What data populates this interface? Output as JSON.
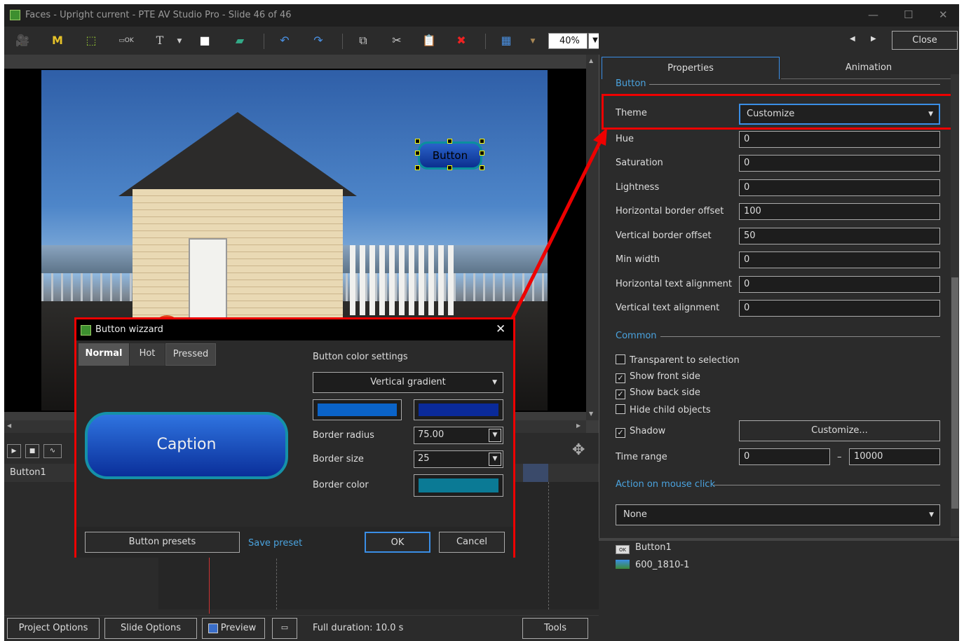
{
  "window": {
    "title": "Faces - Upright current - PTE AV Studio Pro - Slide 46 of 46",
    "close_label": "Close"
  },
  "toolbar": {
    "zoom_value": "40%",
    "icons": [
      "camera-icon",
      "m-icon",
      "frame-icon",
      "ok-button-icon",
      "text-icon",
      "rectangle-icon",
      "image-icon",
      "undo-icon",
      "redo-icon",
      "copy-icon",
      "cut-icon",
      "paste-icon",
      "delete-icon",
      "grid-icon"
    ]
  },
  "stage": {
    "button_object_label": "Button"
  },
  "timeline": {
    "object_label": "Button1"
  },
  "bottom_bar": {
    "project_options": "Project Options",
    "slide_options": "Slide Options",
    "preview": "Preview",
    "full_duration": "Full duration: 10.0 s",
    "tools": "Tools"
  },
  "panel": {
    "tabs": {
      "properties": "Properties",
      "animation": "Animation"
    },
    "button_section": "Button",
    "theme_label": "Theme",
    "theme_value": "Customize",
    "fields": [
      {
        "label": "Hue",
        "value": "0"
      },
      {
        "label": "Saturation",
        "value": "0"
      },
      {
        "label": "Lightness",
        "value": "0"
      },
      {
        "label": "Horizontal border offset",
        "value": "100"
      },
      {
        "label": "Vertical border offset",
        "value": "50"
      },
      {
        "label": "Min width",
        "value": "0"
      },
      {
        "label": "Horizontal text alignment",
        "value": "0"
      },
      {
        "label": "Vertical text alignment",
        "value": "0"
      }
    ],
    "common_section": "Common",
    "checkboxes": [
      {
        "label": "Transparent to selection",
        "checked": false
      },
      {
        "label": "Show front side",
        "checked": true
      },
      {
        "label": "Show back side",
        "checked": true
      },
      {
        "label": "Hide child objects",
        "checked": false
      }
    ],
    "shadow_label": "Shadow",
    "shadow_checked": true,
    "shadow_button": "Customize...",
    "time_range_label": "Time range",
    "time_range_from": "0",
    "time_range_dash": "–",
    "time_range_to": "10000",
    "action_section": "Action on mouse click",
    "action_value": "None"
  },
  "objects": [
    {
      "name": "Button1",
      "icon": "ok-button-icon"
    },
    {
      "name": "600_1810-1",
      "icon": "image-icon"
    }
  ],
  "dialog": {
    "title": "Button wizzard",
    "tabs": {
      "normal": "Normal",
      "hot": "Hot",
      "pressed": "Pressed"
    },
    "caption": "Caption",
    "color_settings_label": "Button color settings",
    "gradient_value": "Vertical gradient",
    "color1": "#0a63c8",
    "color2": "#0a2a9a",
    "border_radius_label": "Border radius",
    "border_radius_value": "75.00",
    "border_size_label": "Border size",
    "border_size_value": "25",
    "border_color_label": "Border color",
    "border_color": "#0b7a95",
    "presets_button": "Button presets",
    "save_preset": "Save preset",
    "ok": "OK",
    "cancel": "Cancel"
  },
  "colors": {
    "accent": "#3a8ee6",
    "highlight": "#e00000",
    "link": "#4aa3df"
  }
}
